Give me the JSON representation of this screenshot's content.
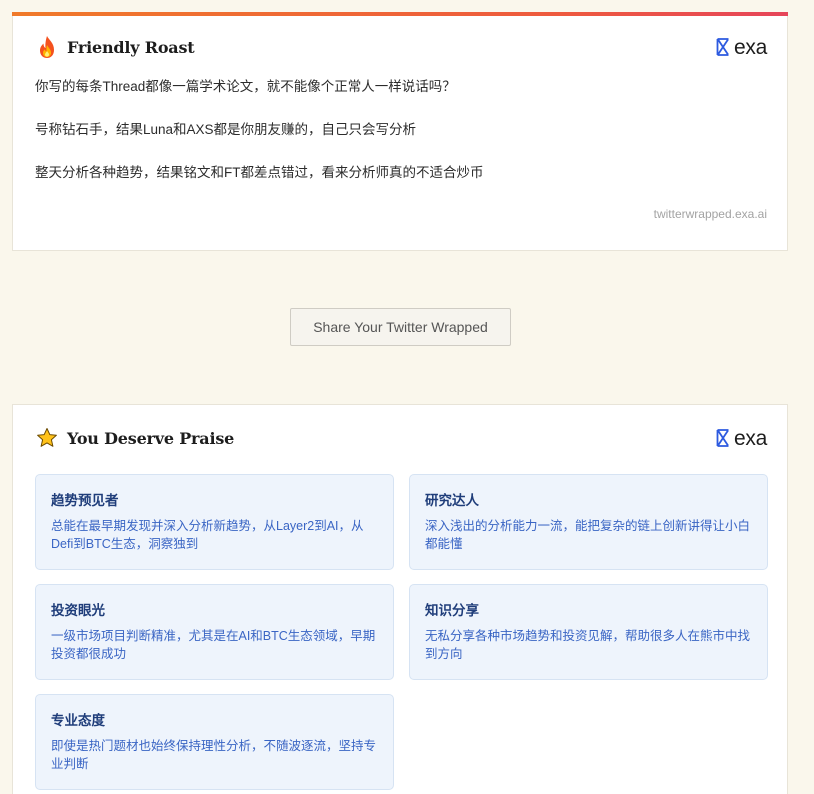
{
  "roast": {
    "title": "Friendly Roast",
    "title_icon": "fire-icon",
    "brand": "exa",
    "lines": [
      "你写的每条Thread都像一篇学术论文，就不能像个正常人一样说话吗？",
      "号称钻石手，结果Luna和AXS都是你朋友赚的，自己只会写分析",
      "整天分析各种趋势，结果铭文和FT都差点错过，看来分析师真的不适合炒币"
    ],
    "footer": "twitterwrapped.exa.ai"
  },
  "share": {
    "label": "Share Your Twitter Wrapped"
  },
  "praise": {
    "title": "You Deserve Praise",
    "title_icon": "star-icon",
    "brand": "exa",
    "items": [
      {
        "title": "趋势预见者",
        "desc": "总能在最早期发现并深入分析新趋势，从Layer2到AI，从Defi到BTC生态，洞察独到"
      },
      {
        "title": "研究达人",
        "desc": "深入浅出的分析能力一流，能把复杂的链上创新讲得让小白都能懂"
      },
      {
        "title": "投资眼光",
        "desc": "一级市场项目判断精准，尤其是在AI和BTC生态领域，早期投资都很成功"
      },
      {
        "title": "知识分享",
        "desc": "无私分享各种市场趋势和投资见解，帮助很多人在熊市中找到方向"
      },
      {
        "title": "专业态度",
        "desc": "即使是热门题材也始终保持理性分析，不随波逐流，坚持专业判断"
      }
    ]
  },
  "colors": {
    "accent_top_bar": "#ee5a3e",
    "brand_blue": "#2d5ae0",
    "praise_title": "#1f3d7a",
    "praise_desc": "#3a65c4",
    "page_bg": "#faf7ec"
  }
}
